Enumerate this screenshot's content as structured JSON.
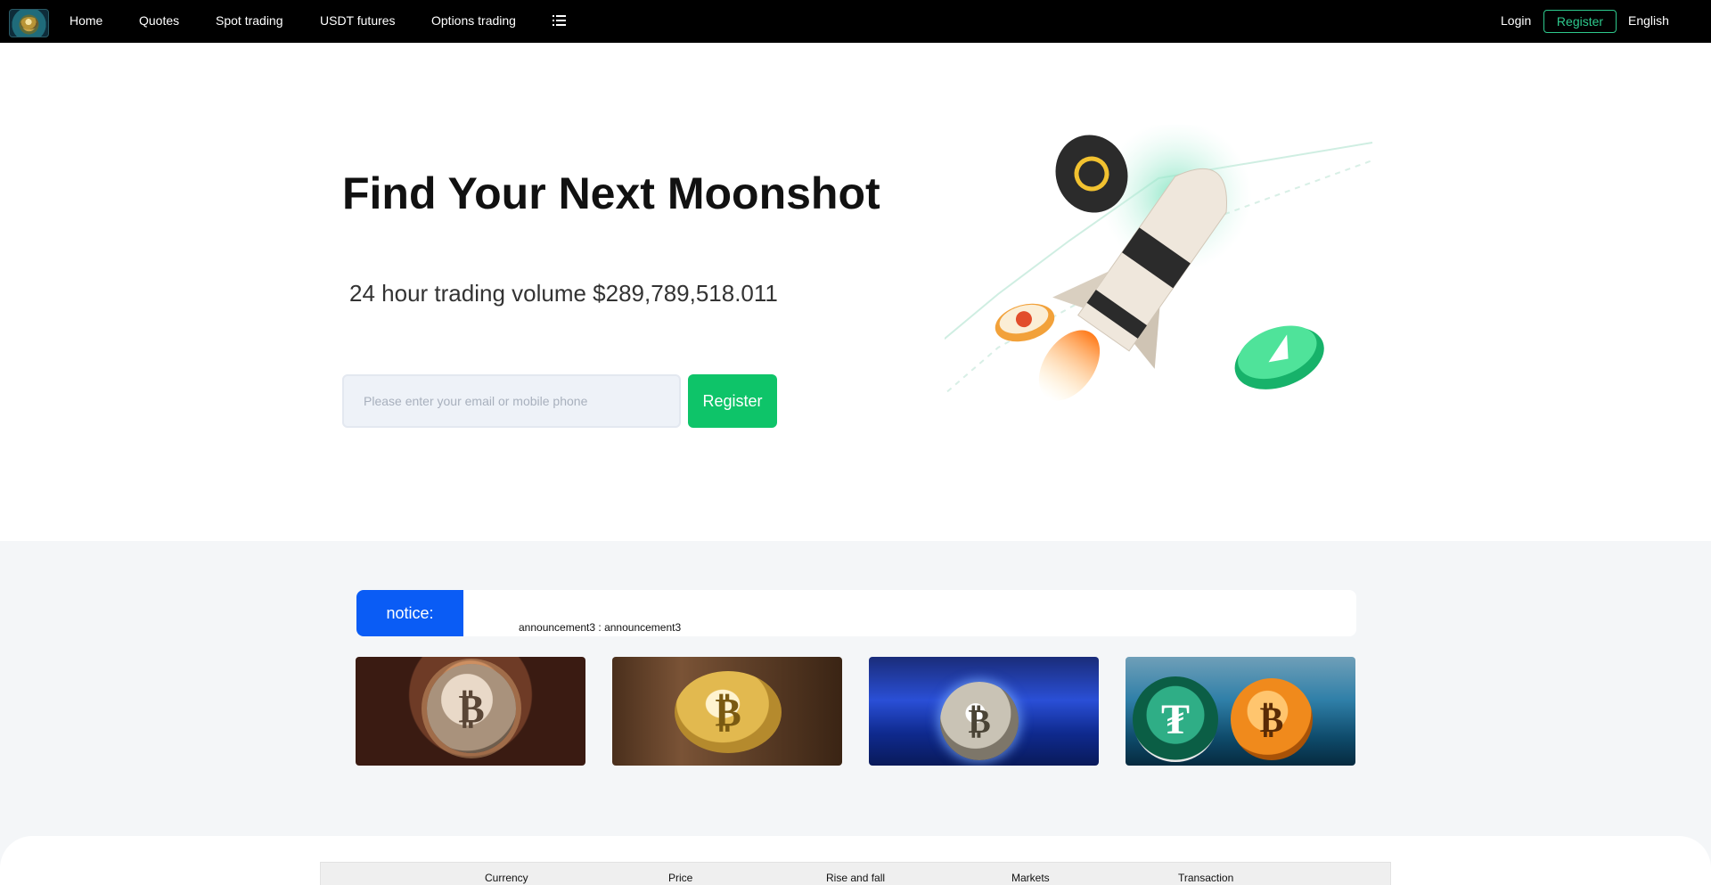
{
  "nav": {
    "items": [
      "Home",
      "Quotes",
      "Spot trading",
      "USDT futures",
      "Options trading"
    ],
    "login": "Login",
    "register": "Register",
    "language": "English"
  },
  "hero": {
    "title": "Find Your Next Moonshot",
    "volume": "24 hour trading volume $289,789,518.011",
    "input_placeholder": "Please enter your email or mobile phone",
    "register_button": "Register"
  },
  "notice": {
    "label": "notice:",
    "text": "announcement3 : announcement3"
  },
  "banners": [
    {
      "coin_symbol": "₿"
    },
    {
      "coin_symbol": "₿"
    },
    {
      "coin_symbol": "₿"
    },
    {
      "coin_symbol": "₮",
      "coin_symbol_2": "₿"
    }
  ],
  "market_table": {
    "headers": [
      "Currency",
      "Price",
      "Rise and fall",
      "Markets",
      "Transaction"
    ]
  },
  "colors": {
    "brand_green": "#0ec469",
    "notice_blue": "#0a5cf5",
    "register_outline": "#2ec98d"
  }
}
